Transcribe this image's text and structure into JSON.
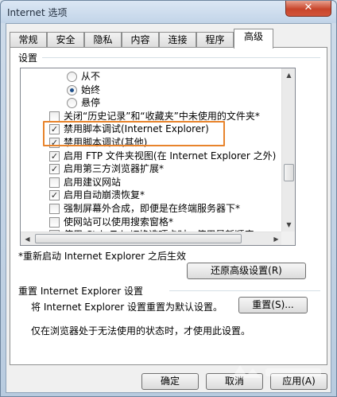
{
  "window": {
    "title": "Internet 选项",
    "close_glyph": "✕"
  },
  "tabs": [
    "常规",
    "安全",
    "隐私",
    "内容",
    "连接",
    "程序",
    "高级"
  ],
  "active_tab": "高级",
  "settings": {
    "group_label": "设置",
    "items": [
      {
        "type": "radio",
        "label": "从不",
        "checked": false
      },
      {
        "type": "radio",
        "label": "始终",
        "checked": true
      },
      {
        "type": "radio",
        "label": "悬停",
        "checked": false
      },
      {
        "type": "checkbox",
        "label": "关闭“历史记录”和“收藏夹”中未使用的文件夹*",
        "checked": false
      },
      {
        "type": "checkbox",
        "label": "禁用脚本调试(Internet Explorer)",
        "checked": true
      },
      {
        "type": "checkbox",
        "label": "禁用脚本调试(其他)",
        "checked": true
      },
      {
        "type": "checkbox",
        "label": "启用 FTP 文件夹视图(在 Internet Explorer 之外)",
        "checked": true
      },
      {
        "type": "checkbox",
        "label": "启用第三方浏览器扩展*",
        "checked": true
      },
      {
        "type": "checkbox",
        "label": "启用建议网站",
        "checked": false
      },
      {
        "type": "checkbox",
        "label": "启用自动崩溃恢复*",
        "checked": true
      },
      {
        "type": "checkbox",
        "label": "强制屏幕外合成，即便是在终端服务器下*",
        "checked": false
      },
      {
        "type": "checkbox",
        "label": "使网站可以使用搜索窗格*",
        "checked": false
      },
      {
        "type": "checkbox",
        "label": "使用 Ctrl+Tab 切换选项卡时，使用最新顺序",
        "checked": false
      }
    ],
    "restart_note": "*重新启动 Internet Explorer 之后生效",
    "restore_button": "还原高级设置(R)"
  },
  "reset": {
    "group_label": "重置 Internet Explorer 设置",
    "description": "将 Internet Explorer 设置重置为默认设置。",
    "button": "重置(S)...",
    "note": "仅在浏览器处于无法使用的状态时，才使用此设置。"
  },
  "footer": {
    "ok": "确定",
    "cancel": "取消",
    "apply": "应用(A)"
  },
  "check_glyph": "✓",
  "colors": {
    "highlight": "#e8842c"
  }
}
